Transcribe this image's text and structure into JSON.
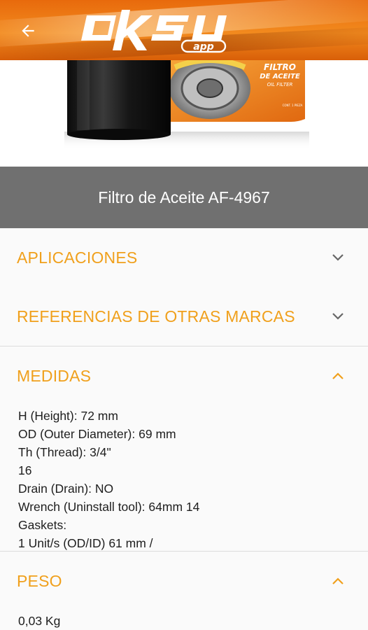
{
  "header": {
    "logo_text": "oksu",
    "logo_sub": "app",
    "back_icon": "arrow-left-icon"
  },
  "product": {
    "box_text_line1": "FILTRO",
    "box_text_line2": "DE ACEITE",
    "box_text_line3": "OIL FILTER",
    "box_text_line4": "CONT. 1 PIEZA",
    "title": "Filtro de Aceite AF-4967"
  },
  "sections": {
    "aplicaciones": {
      "title": "APLICACIONES",
      "expanded": false
    },
    "referencias": {
      "title": "REFERENCIAS DE OTRAS MARCAS",
      "expanded": false
    },
    "medidas": {
      "title": "MEDIDAS",
      "expanded": true,
      "lines": [
        "H (Height): 72 mm",
        "OD (Outer Diameter): 69 mm",
        "Th (Thread): 3/4\"",
        "16",
        "Drain (Drain): NO",
        "Wrench (Uninstall tool): 64mm 14",
        "Gaskets:",
        "1 Unit/s (OD/ID) 61 mm /"
      ]
    },
    "peso": {
      "title": "PESO",
      "expanded": true,
      "lines": [
        "0,03 Kg"
      ]
    }
  },
  "colors": {
    "accent": "#f0a01c",
    "header_orange": "#e86a0c",
    "title_bar": "#707070"
  }
}
